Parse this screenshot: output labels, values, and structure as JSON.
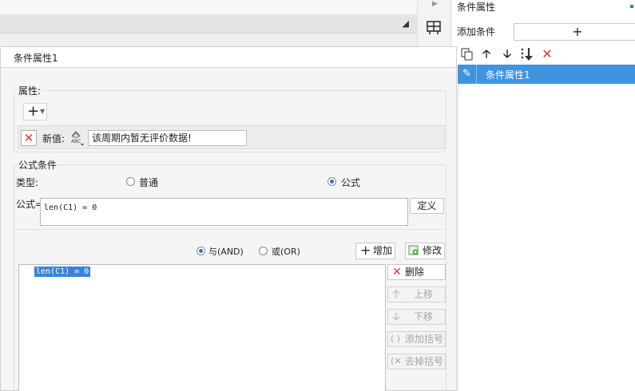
{
  "right_panel": {
    "title": "条件属性",
    "add_condition_label": "添加条件",
    "add_button": "+",
    "toolbar_icons": [
      "copy-icon",
      "arrow-up-icon",
      "arrow-down-icon",
      "sort-down-icon",
      "delete-x-icon"
    ],
    "list_items": [
      {
        "label": "条件属性1",
        "selected": true
      }
    ]
  },
  "dialog": {
    "tab_label": "条件属性1",
    "attributes": {
      "group_label": "属性:",
      "new_value_label": "新值:",
      "new_value_text": "该周期内暂无评价数据!"
    },
    "formula_condition": {
      "group_label": "公式条件",
      "type_label": "类型:",
      "type_options": [
        "普通",
        "公式"
      ],
      "selected_type": "公式",
      "formula_prefix": "公式=",
      "formula_text": "len(C1) = 0",
      "define_button": "定义",
      "logic_options": [
        "与(AND)",
        "或(OR)"
      ],
      "selected_logic": "与(AND)",
      "add_button": "增加",
      "modify_button": "修改",
      "delete_button": "删除",
      "move_up_button": "上移",
      "move_down_button": "下移",
      "add_bracket_button": "添加括号",
      "remove_bracket_button": "去掉括号",
      "conditions": [
        "len(C1) = 0"
      ]
    }
  }
}
